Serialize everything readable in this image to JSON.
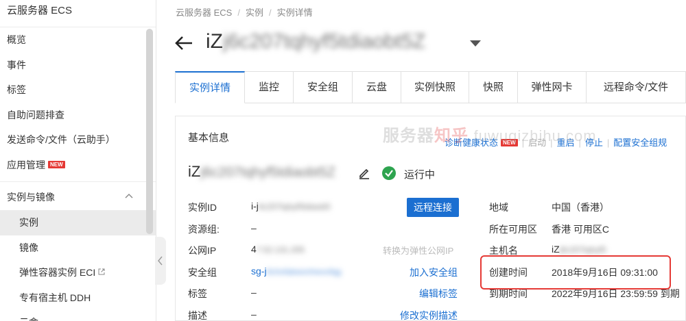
{
  "sidebar": {
    "title": "云服务器 ECS",
    "items": [
      {
        "label": "概览"
      },
      {
        "label": "事件"
      },
      {
        "label": "标签"
      },
      {
        "label": "自助问题排查"
      },
      {
        "label": "发送命令/文件（云助手）"
      },
      {
        "label": "应用管理",
        "badge": "NEW"
      }
    ],
    "group": {
      "label": "实例与镜像",
      "items": [
        {
          "label": "实例",
          "active": true
        },
        {
          "label": "镜像"
        },
        {
          "label": "弹性容器实例 ECI"
        },
        {
          "label": "专有宿主机 DDH"
        },
        {
          "label": "云盒"
        }
      ]
    }
  },
  "breadcrumb": [
    "云服务器 ECS",
    "实例",
    "实例详情"
  ],
  "instance": {
    "prefix": "iZ",
    "blurred_suffix": "j6c207tqhyf5tdiaobt5Z",
    "status": "运行中",
    "status_color": "#2ea44f"
  },
  "tabs": [
    "实例详情",
    "监控",
    "安全组",
    "云盘",
    "实例快照",
    "快照",
    "弹性网卡",
    "远程命令/文件"
  ],
  "card": {
    "title": "基本信息",
    "actions": {
      "diagnose": "诊断健康状态",
      "diagnose_badge": "NEW",
      "start": "启动",
      "restart": "重启",
      "stop": "停止",
      "config_sg": "配置安全组规"
    },
    "left": {
      "instance_id_label": "实例ID",
      "instance_id_prefix": "i-j",
      "instance_id_blur": "6c207tqhyf5tdiaob5",
      "resource_group_label": "资源组:",
      "resource_group_value": "–",
      "public_ip_label": "公网IP",
      "public_ip_prefix": "4",
      "public_ip_blur": "7.52.131.205",
      "public_ip_action": "转换为弹性公网IP",
      "security_group_label": "安全组",
      "security_group_prefix": "sg-j",
      "security_group_blur": "6chxfabwonhwvofqg",
      "tags_label": "标签",
      "tags_value": "–",
      "desc_label": "描述",
      "desc_value": "–",
      "remote_connect": "远程连接",
      "join_sg": "加入安全组",
      "edit_tags": "编辑标签",
      "edit_desc": "修改实例描述"
    },
    "right": {
      "region_label": "地域",
      "region_value": "中国（香港）",
      "zone_label": "所在可用区",
      "zone_value": "香港 可用区C",
      "hostname_label": "主机名",
      "hostname_prefix": "iZ",
      "hostname_blur": "j6c207tqhyf5",
      "created_label": "创建时间",
      "created_value": "2018年9月16日 09:31:00",
      "expire_label": "到期时间",
      "expire_value": "2022年9月16日 23:59:59 到期"
    }
  },
  "watermark": {
    "part1": "服务器",
    "part2": "知乎",
    "part3": "fuwuqizhihu.com"
  },
  "colors": {
    "accent": "#1b6fd1",
    "highlight": "#e53935"
  }
}
